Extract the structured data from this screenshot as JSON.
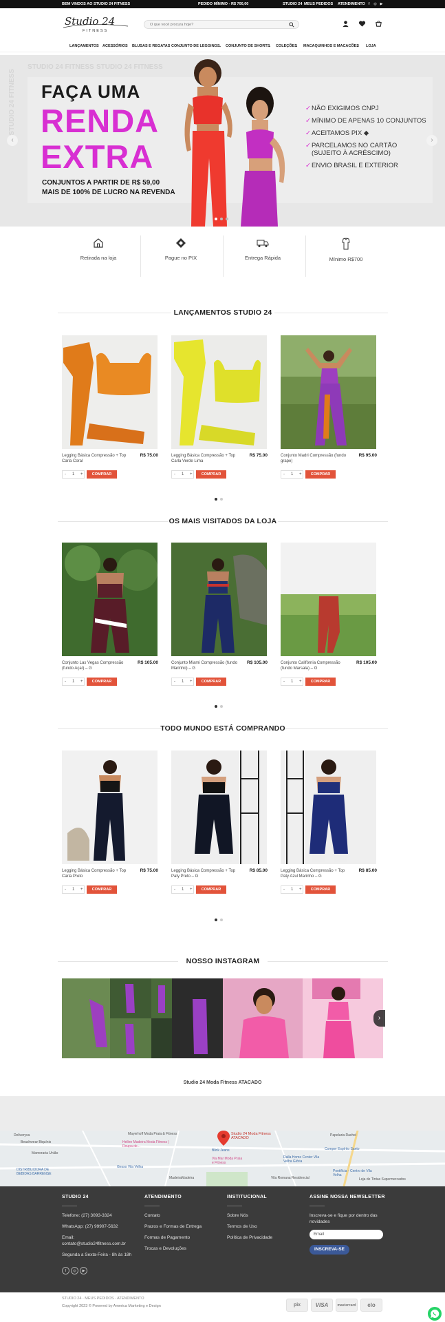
{
  "topbar": {
    "welcome": "BEM VINDOS AO STUDIO 24 FITNESS",
    "minimum": "PEDIDO MÍNIMO - R$ 700,00",
    "links": [
      "STUDIO 24",
      "MEUS PEDIDOS",
      "ATENDIMENTO"
    ]
  },
  "header": {
    "logo_text": "Studio 24",
    "logo_sub": "FITNESS",
    "search_placeholder": "O que você procura hoje?"
  },
  "nav": {
    "items": [
      "LANÇAMENTOS",
      "ACESSÓRIOS",
      "BLUSAS E REGATAS",
      "CONJUNTO DE LEGGINGS",
      "CONJUNTO DE SHORTS",
      "COLEÇÕES",
      "MACAQUINHOS E MACACÕES",
      "LOJA"
    ]
  },
  "hero": {
    "watermark": "STUDIO 24 FITNESS",
    "line1": "FAÇA UMA",
    "line2": "RENDA",
    "line3": "EXTRA",
    "sub1": "CONJUNTOS A PARTIR DE R$ 59,00",
    "sub2": "MAIS DE 100% DE LUCRO NA REVENDA",
    "bullets": [
      "NÃO EXIGIMOS CNPJ",
      "MÍNIMO DE APENAS 10 CONJUNTOS",
      "ACEITAMOS PIX",
      "PARCELAMOS NO CARTÃO",
      "(SUJEITO À ACRÉSCIMO)",
      "ENVIO BRASIL E EXTERIOR"
    ],
    "colors": {
      "accent": "#d82fd2",
      "bg": "#e7e7e7"
    }
  },
  "features": [
    "Retirada na loja",
    "Pague no PIX",
    "Entrega Rápida",
    "Mínimo R$700"
  ],
  "sections": {
    "launches": "LANÇAMENTOS STUDIO 24",
    "visited": "OS MAIS VISITADOS DA LOJA",
    "buying": "TODO MUNDO ESTÁ COMPRANDO",
    "instagram": "NOSSO INSTAGRAM"
  },
  "buy_label": "COMPRAR",
  "qty_default": "1",
  "products_launch": [
    {
      "name": "Legging Básica Compressão + Top Carla Coral",
      "price": "R$ 75.00"
    },
    {
      "name": "Legging Básica Compressão + Top Carla Verde Lima",
      "price": "R$ 75.00"
    },
    {
      "name": "Conjunto Madri Compressão (fundo grape)",
      "price": "R$ 95.00"
    }
  ],
  "products_visited": [
    {
      "name": "Conjunto Las Vegas Compressão (fundo Açaí) – G",
      "price": "R$ 105.00"
    },
    {
      "name": "Conjunto Miami Compressão (fundo Marinho) – G",
      "price": "R$ 105.00"
    },
    {
      "name": "Conjunto Califórnia Compressão (fundo Marsala) – G",
      "price": "R$ 105.00"
    }
  ],
  "products_buying": [
    {
      "name": "Legging Básica Compressão + Top Carla Preto",
      "price": "R$ 75.00"
    },
    {
      "name": "Legging Básica Compressão + Top Paty Preto – G",
      "price": "R$ 85.00"
    },
    {
      "name": "Legging Básica Compressão + Top Paty Azul Marinho – G",
      "price": "R$ 85.00"
    }
  ],
  "instagram_caption": "Studio 24 Moda Fitness ATACADO",
  "map": {
    "labels": [
      "Studio 24 Moda Fitness ATACADO",
      "Hellen Madeira Moda Fitness | Roupa de...",
      "Blink Jeans",
      "Via Mar Moda Praia e Fitness",
      "Dalla Home Center Vila Velha Glória",
      "Papelaria Rachel",
      "Mayerhoff Moda Praia & Fitness",
      "DISTRIBUIDORA DE BEBIDAS BARRENSE",
      "Gesso Vila Velha",
      "Deliveryxa",
      "Beachwear Biquínis",
      "Mamoraria União",
      "MadeiraMadeira",
      "Vila Romana Residencial",
      "Pontifícia - Centro de Vila Velha",
      "Loja de Tintas Supermercados",
      "Comper Espírito Santo"
    ]
  },
  "footer": {
    "col1": {
      "title": "STUDIO 24",
      "phone": "Telefone: (27) 3093-3324",
      "whatsapp": "WhatsApp: (27) 99907-5632",
      "email_label": "Email:",
      "email": "contato@studio24fitness.com.br",
      "hours": "Segunda a Sexta-Feira - 8h às 18h"
    },
    "col2": {
      "title": "ATENDIMENTO",
      "items": [
        "Contato",
        "Prazos e Formas de Entrega",
        "Formas de Pagamento",
        "Trocas e Devoluções"
      ]
    },
    "col3": {
      "title": "INSTITUCIONAL",
      "items": [
        "Sobre Nós",
        "Termos de Uso",
        "Política de Privacidade"
      ]
    },
    "col4": {
      "title": "ASSINE NOSSA NEWSLETTER",
      "text": "Inscreva-se e fique por dentro das novidades",
      "email_placeholder": "Email",
      "button": "INSCREVA-SE"
    }
  },
  "bottom": {
    "links": "STUDIO 24 · MEUS PEDIDOS · ATENDIMENTO",
    "copyright": "Copyright 2023 © Powered by America Marketing e Design",
    "payments": [
      "pix",
      "VISA",
      "mastercard",
      "elo"
    ]
  }
}
